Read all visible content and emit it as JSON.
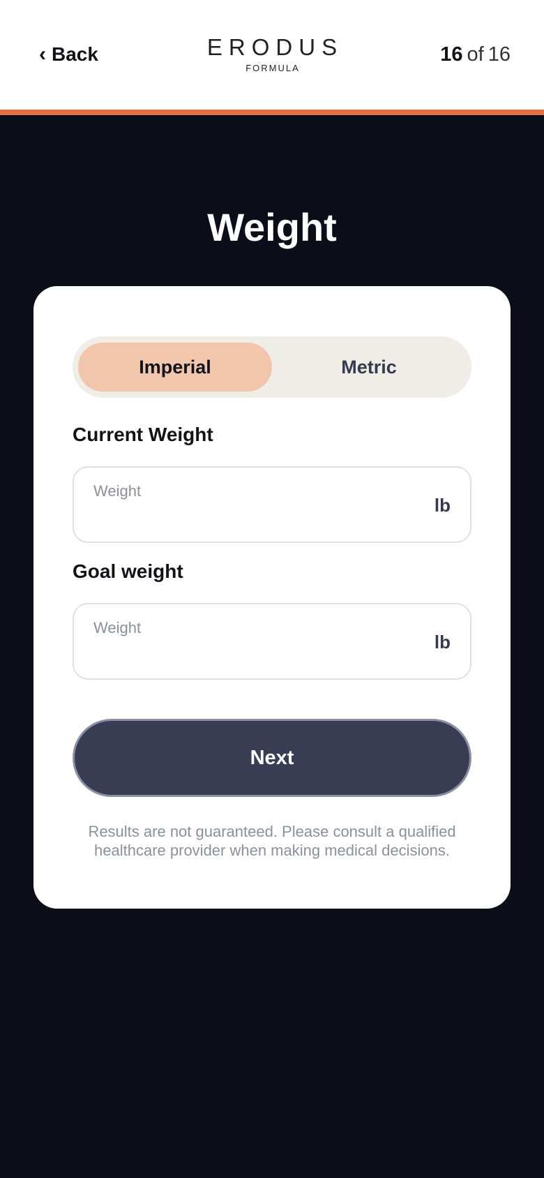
{
  "header": {
    "back_chevron": "‹",
    "back_label": "Back",
    "logo_main": "ERODUS",
    "logo_sub": "FORMULA",
    "step_current": "16",
    "step_of": "of",
    "step_total": "16"
  },
  "page": {
    "title": "Weight"
  },
  "units_toggle": {
    "options": [
      "Imperial",
      "Metric"
    ],
    "selected": "Imperial"
  },
  "fields": {
    "current": {
      "label": "Current Weight",
      "placeholder": "Weight",
      "value": "",
      "unit": "lb"
    },
    "goal": {
      "label": "Goal weight",
      "placeholder": "Weight",
      "value": "",
      "unit": "lb"
    }
  },
  "actions": {
    "next_label": "Next"
  },
  "disclaimer": "Results are not guaranteed. Please consult a qualified healthcare provider when making medical decisions.",
  "colors": {
    "accent": "#e2713f",
    "background": "#0b0d18",
    "toggle_active": "#f2c5ad",
    "button": "#383d53"
  },
  "icons": {
    "back": "chevron-left-icon"
  }
}
